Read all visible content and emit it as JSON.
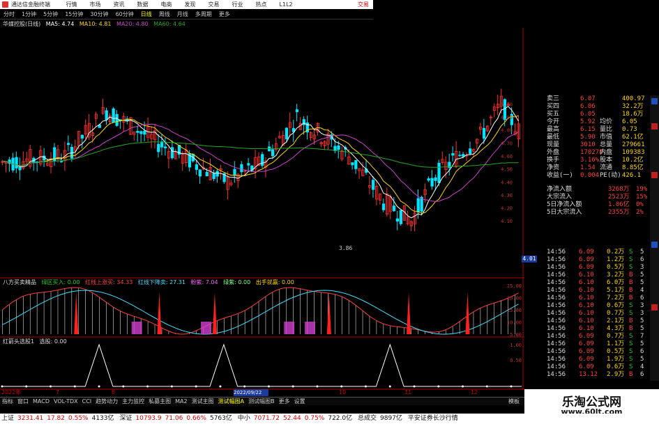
{
  "titlebar": {
    "app_title": "通达信金融终端",
    "menus": [
      "行情",
      "市场",
      "资讯",
      "数据",
      "电商",
      "发现",
      "交易",
      "行业",
      "热点",
      "L1L2"
    ],
    "trade_label": "交易"
  },
  "toolbar": {
    "items": [
      "分时",
      "1分钟",
      "5分钟",
      "15分钟",
      "30分钟",
      "60分钟",
      "日线",
      "周线",
      "月线",
      "多周期",
      "更多"
    ],
    "selected": "日线"
  },
  "ma_legend": {
    "stock": "华媒控股(日线)",
    "ma5": "MA5: 4.74",
    "ma10": "MA10: 4.81",
    "ma20": "MA20: 4.80",
    "ma60": "MA60: 4.64"
  },
  "colors": {
    "ma5": "#ffffff",
    "ma10": "#ffd700",
    "ma20": "#d040d0",
    "ma60": "#22aa22",
    "up": "#ff3030",
    "down": "#00e5ff",
    "axis": "#b00000"
  },
  "chart_data": [
    {
      "type": "candlestick",
      "title": "华媒控股(日线)",
      "ylim": [
        3.86,
        5.05
      ],
      "yticks": [
        "5.00",
        "4.90",
        "4.80",
        "4.70",
        "4.60",
        "4.50",
        "4.40",
        "4.30",
        "4.20",
        "4.10"
      ],
      "low_marker": "3.86",
      "current_price": "4.01",
      "date_axis": [
        "2022年",
        "7",
        "8",
        "9",
        "10",
        "11",
        "12"
      ],
      "date_highlight": "2022/09/22",
      "series": [
        {
          "name": "MA5",
          "value": "4.74"
        },
        {
          "name": "MA10",
          "value": "4.81"
        },
        {
          "name": "MA20",
          "value": "4.80"
        },
        {
          "name": "MA60",
          "value": "4.64"
        }
      ]
    },
    {
      "type": "area",
      "title": "八方买卖精品",
      "yticks": [
        "25.00",
        "20.00",
        "15.00",
        "10.00",
        "5.00"
      ],
      "legend": [
        "绿区买入: 0.00",
        "红线上涨买: 34.33",
        "红线下降卖: 27.31",
        "粉紫: 7.04",
        "绿紫: 0.00",
        "出手就赢: 0.00"
      ]
    },
    {
      "type": "line",
      "title": "红箭头选股1",
      "legend": [
        "红箭头选股1",
        "选股: 0.00"
      ],
      "yticks": [
        "1.00",
        "0.50"
      ]
    }
  ],
  "quote": {
    "rows": [
      {
        "label": "卖三",
        "price": "6.07",
        "vol": "400.97"
      },
      {
        "label": "买四",
        "price": "6.06",
        "vol": "32.2万"
      },
      {
        "label": "买五",
        "price": "6.05",
        "vol": "18.6万"
      },
      {
        "label": "今开",
        "price": "5.92",
        "l2": "均价",
        "v2": "6.05"
      },
      {
        "label": "最高",
        "price": "6.15",
        "l2": "量比",
        "v2": "0.73"
      },
      {
        "label": "最低",
        "price": "5.90",
        "l2": "市值",
        "v2": "62.1亿"
      },
      {
        "label": "现量",
        "price": "3010",
        "l2": "总量",
        "v2": "279661"
      },
      {
        "label": "外盘",
        "price": "170278",
        "l2": "内盘",
        "v2": "109383"
      },
      {
        "label": "换手",
        "price": "3.16%",
        "l2": "股本",
        "v2": "10.2亿"
      },
      {
        "label": "净资",
        "price": "1.54",
        "l2": "流通",
        "v2": "8.85亿"
      },
      {
        "label": "收益(一)",
        "price": "0.004",
        "l2": "PE(动)",
        "v2": "426.1"
      }
    ],
    "flows": [
      {
        "label": "净流入额",
        "value": "3268万",
        "pct": "19%"
      },
      {
        "label": "大宗流入",
        "value": "2523万",
        "pct": "15%"
      },
      {
        "label": "5日净流入额",
        "value": "1.06亿",
        "pct": "0%"
      },
      {
        "label": "5日大宗流入",
        "value": "2355万",
        "pct": "2%"
      }
    ]
  },
  "ticks": [
    {
      "time": "14:56",
      "price": "6.09",
      "vol": "0.2万",
      "bs": "S",
      "n": "5"
    },
    {
      "time": "14:56",
      "price": "6.09",
      "vol": "1.2万",
      "bs": "S",
      "n": "6"
    },
    {
      "time": "14:56",
      "price": "6.09",
      "vol": "0.5万",
      "bs": "S",
      "n": "3"
    },
    {
      "time": "14:56",
      "price": "6.10",
      "vol": "3.2万",
      "bs": "B",
      "n": "5"
    },
    {
      "time": "14:56",
      "price": "6.10",
      "vol": "6.0万",
      "bs": "B",
      "n": "5"
    },
    {
      "time": "14:56",
      "price": "6.10",
      "vol": "5.1万",
      "bs": "B",
      "n": "4"
    },
    {
      "time": "14:56",
      "price": "6.10",
      "vol": "7.2万",
      "bs": "B",
      "n": "6"
    },
    {
      "time": "14:56",
      "price": "6.10",
      "vol": "0.6万",
      "bs": "S",
      "n": "3"
    },
    {
      "time": "14:56",
      "price": "6.10",
      "vol": "0.7万",
      "bs": "S",
      "n": "3"
    },
    {
      "time": "14:56",
      "price": "6.10",
      "vol": "2.1万",
      "bs": "B",
      "n": "5"
    },
    {
      "time": "14:56",
      "price": "6.10",
      "vol": "4.3万",
      "bs": "B",
      "n": "5"
    },
    {
      "time": "14:56",
      "price": "6.09",
      "vol": "0.7万",
      "bs": "S",
      "n": "7"
    },
    {
      "time": "14:56",
      "price": "6.09",
      "vol": "1.1万",
      "bs": "S",
      "n": "5"
    },
    {
      "time": "14:56",
      "price": "6.09",
      "vol": "0.5万",
      "bs": "S",
      "n": "6"
    },
    {
      "time": "14:56",
      "price": "6.09",
      "vol": "1.9万",
      "bs": "S",
      "n": "5"
    },
    {
      "time": "14:56",
      "price": "6.09",
      "vol": "0.6万",
      "bs": "S",
      "n": "4"
    },
    {
      "time": "14:56",
      "price": "13.12",
      "vol": "2.9万",
      "bs": "B",
      "n": "6"
    }
  ],
  "tabs": [
    "指标",
    "窗口",
    "MACD",
    "VOL-TDX",
    "CCI",
    "趋势动力",
    "主力监控",
    "私募主图",
    "MA2",
    "测试主图",
    "测试幅图A",
    "测试幅图B",
    "更多",
    "设置"
  ],
  "tab_selected": "测试幅图A",
  "tab_right": "模板",
  "status": [
    {
      "name": "上证",
      "v": "3231.41",
      "c": "17.82",
      "p": "0.55%",
      "a": "4133亿"
    },
    {
      "name": "深证",
      "v": "10793.9",
      "c": "71.06",
      "p": "0.66%",
      "a": "5763亿"
    },
    {
      "name": "中小",
      "v": "7071.72",
      "c": "52.44",
      "p": "0.75%",
      "a": "722.0亿"
    }
  ],
  "status_total": {
    "label": "总成交",
    "value": "9897亿"
  },
  "status_broker": "平安证券长沙行情",
  "watermark": {
    "title": "乐淘公式网",
    "url": "www.60lt.com"
  }
}
